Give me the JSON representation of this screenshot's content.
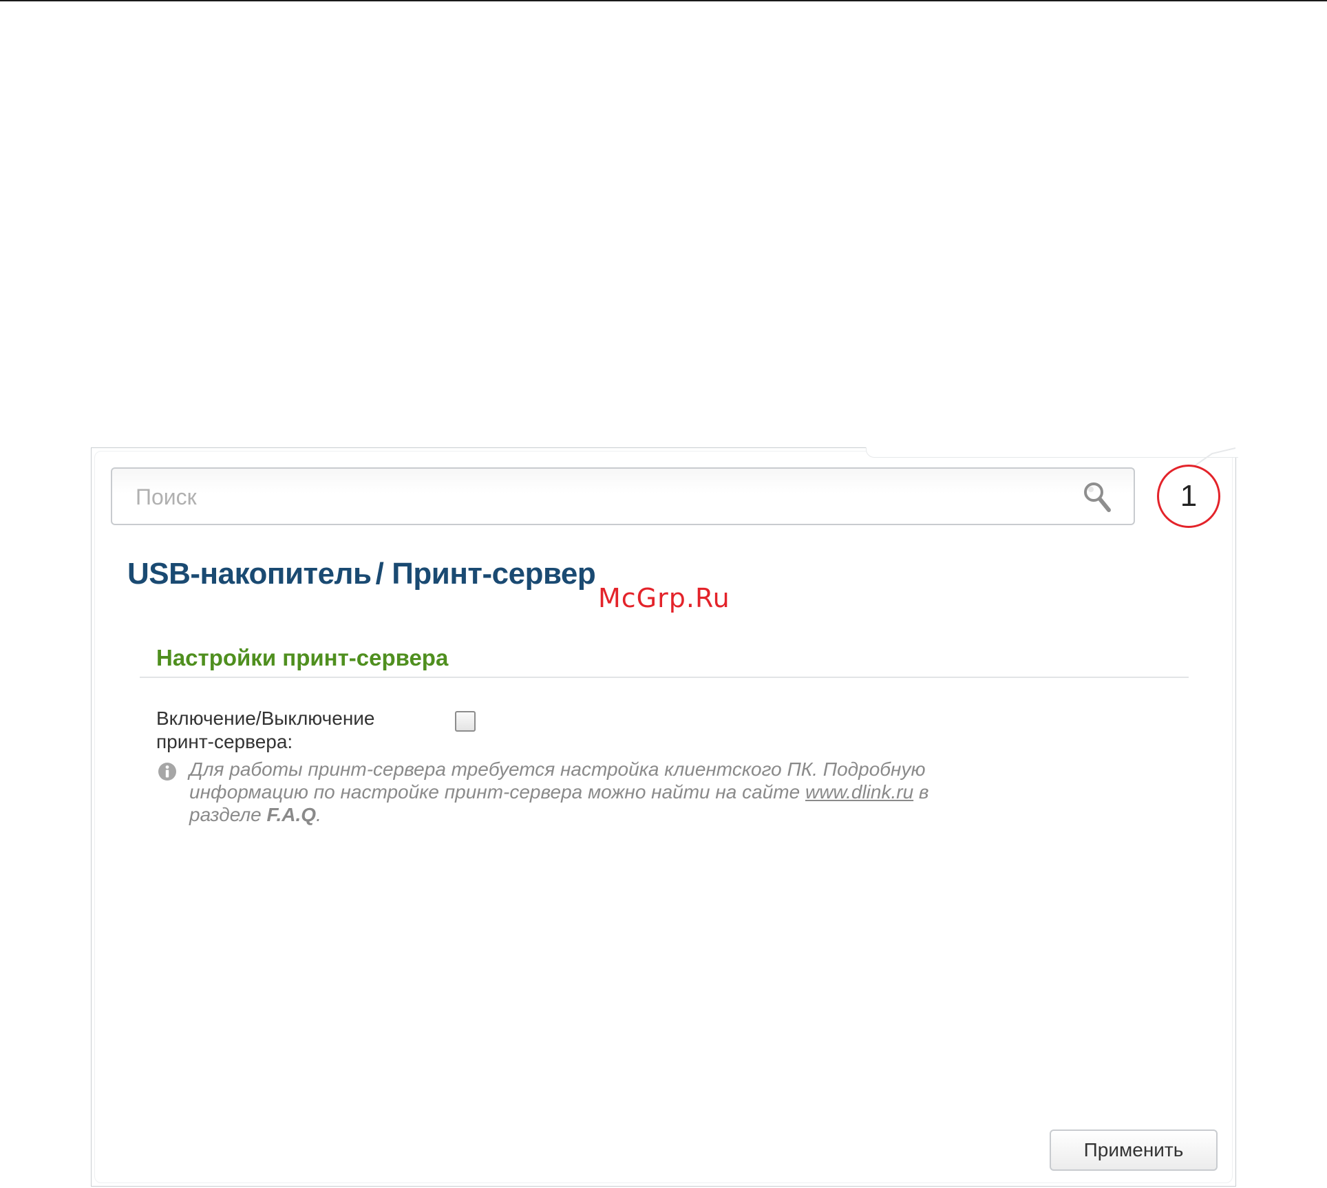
{
  "search": {
    "placeholder": "Поиск",
    "value": ""
  },
  "callout": {
    "number": "1"
  },
  "breadcrumb": {
    "part1": "USB-накопитель",
    "separator": "/",
    "part2": "Принт-сервер"
  },
  "watermark": "McGrp.Ru",
  "section": {
    "title": "Настройки принт-сервера"
  },
  "print_server": {
    "toggle_label": "Включение/Выключение принт-сервера:",
    "enabled": false
  },
  "info": {
    "text_before": "Для работы принт-сервера требуется настройка клиентского ПК. Подробную информацию по настройке принт-сервера можно найти на сайте ",
    "link": "www.dlink.ru",
    "text_middle": " в разделе ",
    "bold": "F.A.Q",
    "text_after": "."
  },
  "actions": {
    "apply_label": "Применить"
  },
  "colors": {
    "title": "#1a4a72",
    "section_title": "#4f8f1f",
    "callout": "#e3232a",
    "watermark": "#e3232a"
  },
  "icons": {
    "search": "search-icon",
    "info": "info-icon"
  }
}
